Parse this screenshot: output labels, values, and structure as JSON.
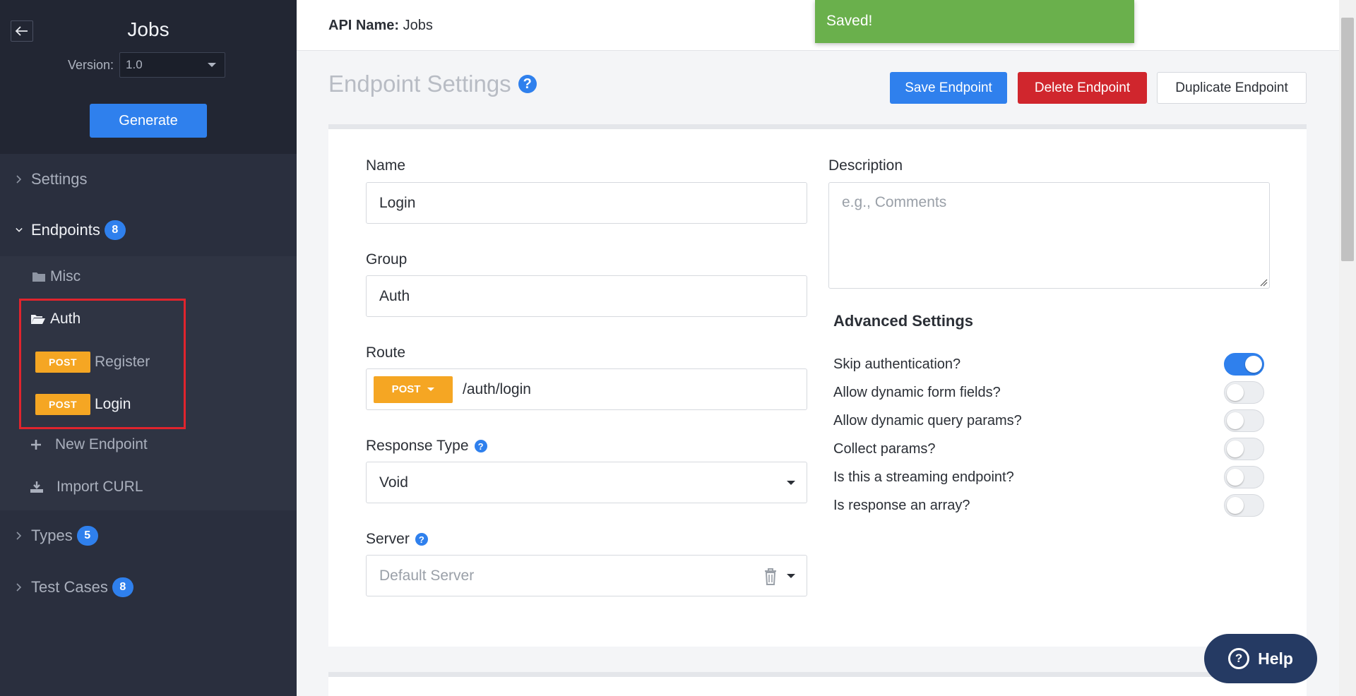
{
  "sidebar": {
    "title": "Jobs",
    "version_label": "Version:",
    "version_value": "1.0",
    "generate_label": "Generate",
    "sections": {
      "settings": "Settings",
      "endpoints": "Endpoints",
      "endpoints_count": "8",
      "types": "Types",
      "types_count": "5",
      "test_cases": "Test Cases",
      "test_cases_count": "8"
    },
    "tree": {
      "misc": "Misc",
      "auth": "Auth",
      "register_method": "POST",
      "register": "Register",
      "login_method": "POST",
      "login": "Login",
      "new_endpoint": "New Endpoint",
      "import_curl": "Import CURL"
    }
  },
  "topbar": {
    "api_name_label": "API Name:",
    "api_name_value": "Jobs",
    "toast": "Saved!"
  },
  "main": {
    "heading": "Endpoint Settings",
    "save_label": "Save Endpoint",
    "delete_label": "Delete Endpoint",
    "duplicate_label": "Duplicate Endpoint",
    "form": {
      "name_label": "Name",
      "name_value": "Login",
      "group_label": "Group",
      "group_value": "Auth",
      "route_label": "Route",
      "route_method": "POST",
      "route_value": "/auth/login",
      "response_type_label": "Response Type",
      "response_type_value": "Void",
      "server_label": "Server",
      "server_value": "Default Server",
      "description_label": "Description",
      "description_placeholder": "e.g., Comments"
    },
    "advanced": {
      "title": "Advanced Settings",
      "options": [
        {
          "label": "Skip authentication?",
          "enabled": true
        },
        {
          "label": "Allow dynamic form fields?",
          "enabled": false
        },
        {
          "label": "Allow dynamic query params?",
          "enabled": false
        },
        {
          "label": "Collect params?",
          "enabled": false
        },
        {
          "label": "Is this a streaming endpoint?",
          "enabled": false
        },
        {
          "label": "Is response an array?",
          "enabled": false
        }
      ]
    }
  },
  "help_button": "Help",
  "colors": {
    "primary": "#2f80ed",
    "danger": "#d0262d",
    "post": "#f5a623",
    "toast": "#6ab04c",
    "sidebar": "#2a2f3e"
  }
}
